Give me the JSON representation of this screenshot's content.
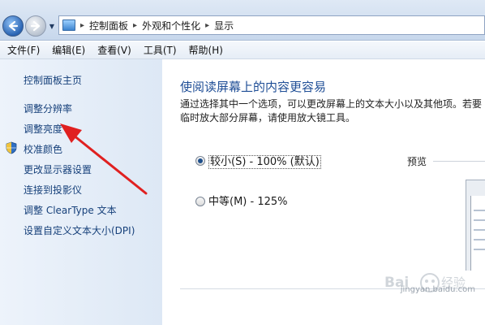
{
  "breadcrumb": [
    "控制面板",
    "外观和个性化",
    "显示"
  ],
  "menu": [
    "文件(F)",
    "编辑(E)",
    "查看(V)",
    "工具(T)",
    "帮助(H)"
  ],
  "sidebar": {
    "home": "控制面板主页",
    "links": [
      "调整分辨率",
      "调整亮度",
      "校准颜色",
      "更改显示器设置",
      "连接到投影仪",
      "调整 ClearType 文本",
      "设置自定义文本大小(DPI)"
    ]
  },
  "main": {
    "title": "使阅读屏幕上的内容更容易",
    "description": "通过选择其中一个选项，可以更改屏幕上的文本大小以及其他项。若要临时放大部分屏幕，请使用放大镜工具。",
    "options": [
      {
        "label": "较小(S) - 100% (默认)",
        "checked": true
      },
      {
        "label": "中等(M) - 125%",
        "checked": false
      }
    ],
    "preview_label": "预览"
  },
  "watermark": "jingyan.baidu.com",
  "colors": {
    "accent": "#1f4e96",
    "link": "#16407a",
    "annotation": "#e02020"
  }
}
